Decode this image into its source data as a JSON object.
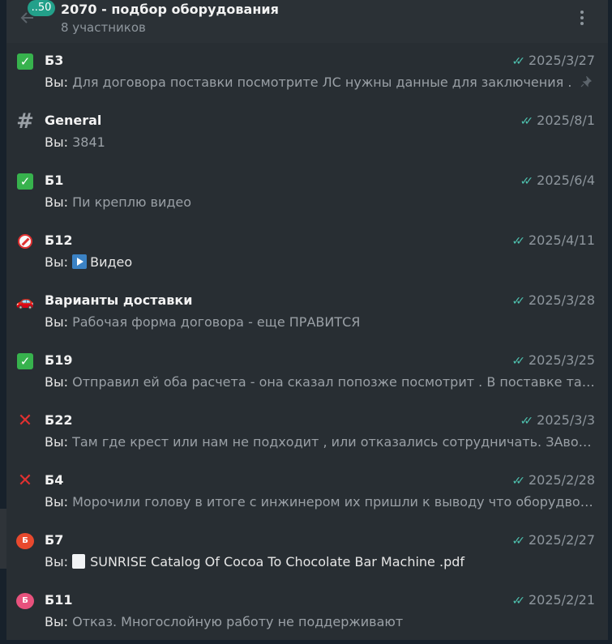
{
  "header": {
    "badge": "..50",
    "title": "2070 - подбор оборудования",
    "subtitle": "8 участников"
  },
  "you_prefix": "Вы: ",
  "chats": [
    {
      "name": "Б3",
      "icon": "check-mark-icon",
      "date": "2025/3/27",
      "preview": "Для договора поставки посмотрите ЛС нужны данные для заключения .",
      "pinned": true
    },
    {
      "name": "General",
      "icon": "hashtag-icon",
      "date": "2025/8/1",
      "preview": "3841"
    },
    {
      "name": "Б1",
      "icon": "check-mark-icon",
      "date": "2025/6/4",
      "preview": "Пи креплю видео"
    },
    {
      "name": "Б12",
      "icon": "no-entry-icon",
      "date": "2025/4/11",
      "preview": "Видео",
      "media": "video"
    },
    {
      "name": "Варианты доставки",
      "icon": "car-icon",
      "date": "2025/3/28",
      "preview": "Рабочая форма договора - еще ПРАВИТСЯ"
    },
    {
      "name": "Б19",
      "icon": "check-mark-icon",
      "date": "2025/3/25",
      "preview": "Отправил ей оба расчета - она сказал попозже посмотрит . В поставке такого де..."
    },
    {
      "name": "Б22",
      "icon": "cross-mark-icon",
      "date": "2025/3/3",
      "preview": "Там где крест или нам не подходит , или отказались сотрудничать. ЗАвод этот за..."
    },
    {
      "name": "Б4",
      "icon": "cross-mark-icon",
      "date": "2025/2/28",
      "preview": "Морочили голову в итоге с инжинером их пришли к выводу что оборудвоание д..."
    },
    {
      "name": "Б7",
      "icon": "avatar-icon",
      "avatar_letter": "Б",
      "avatar_color": "#e8492e",
      "date": "2025/2/27",
      "preview": "SUNRISE Catalog Of Cocoa To Chocolate Bar Machine .pdf",
      "media": "document"
    },
    {
      "name": "Б11",
      "icon": "avatar-icon",
      "avatar_letter": "Б",
      "avatar_color": "#e8527d",
      "date": "2025/2/21",
      "preview": "Отказ. Многослойную работу не поддерживают"
    }
  ]
}
